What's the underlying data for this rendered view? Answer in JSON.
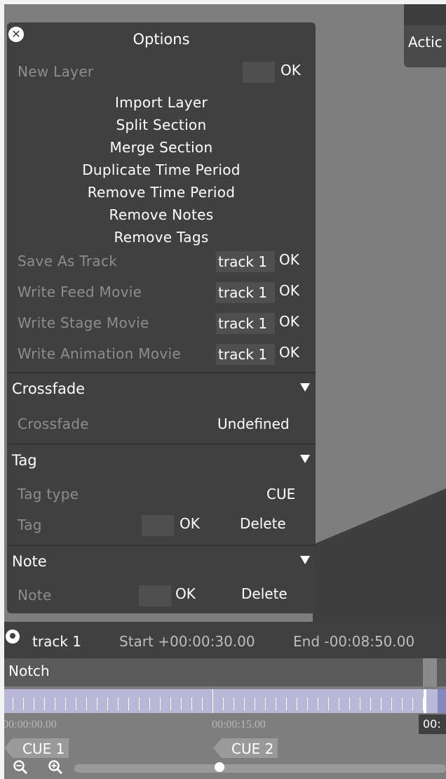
{
  "panel": {
    "title": "Options",
    "new_layer": {
      "label": "New Layer",
      "value": "",
      "ok": "OK"
    },
    "actions": [
      "Import Layer",
      "Split Section",
      "Merge Section",
      "Duplicate Time Period",
      "Remove Time Period",
      "Remove Notes",
      "Remove Tags"
    ],
    "track_rows": [
      {
        "label": "Save As Track",
        "value": "track 1",
        "ok": "OK"
      },
      {
        "label": "Write Feed Movie",
        "value": "track 1",
        "ok": "OK"
      },
      {
        "label": "Write Stage Movie",
        "value": "track 1",
        "ok": "OK"
      },
      {
        "label": "Write Animation Movie",
        "value": "track 1",
        "ok": "OK"
      }
    ],
    "crossfade": {
      "header": "Crossfade",
      "label": "Crossfade",
      "value": "Undefined"
    },
    "tag": {
      "header": "Tag",
      "type_label": "Tag type",
      "type_value": "CUE",
      "tag_label": "Tag",
      "ok": "OK",
      "delete": "Delete"
    },
    "note": {
      "header": "Note",
      "label": "Note",
      "ok": "OK",
      "delete": "Delete"
    }
  },
  "action_box": {
    "label": "Actic"
  },
  "timeline": {
    "track_name": "track 1",
    "start": "Start +00:00:30.00",
    "end": "End -00:08:50.00",
    "layer_name": "Notch",
    "time_labels": [
      "00:00:00.00",
      "00:00:15.00",
      "00:"
    ],
    "cues": [
      "CUE 1",
      "CUE 2"
    ]
  },
  "colors": {
    "panel_bg": "#404040",
    "background": "#7e7e7e",
    "ruler": "#b9b8d7"
  }
}
